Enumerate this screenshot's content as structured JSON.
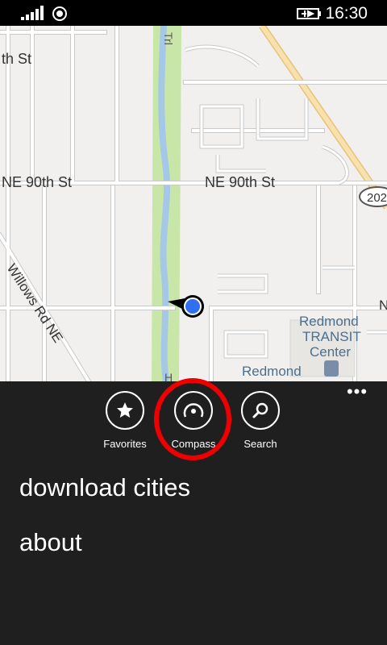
{
  "status_bar": {
    "time": "16:30",
    "icons": [
      "signal-icon",
      "location-icon",
      "battery-charging-icon"
    ]
  },
  "map": {
    "labels": {
      "street_top": "th St",
      "ne90_left": "NE 90th St",
      "ne90_right": "NE 90th St",
      "trl": "Trl",
      "willows": "Willows Rd NE",
      "highway": "202",
      "transit_line1": "Redmond",
      "transit_line2": "TRANSIT",
      "transit_line3": "Center",
      "redmond": "Redmond",
      "n_edge": "N",
      "h_edge": "H"
    },
    "colors": {
      "background": "#f1f0ee",
      "road": "#ffffff",
      "road_outline": "#c9c9c9",
      "park": "#c8e6a8",
      "river": "#a6c8e8",
      "highway": "#f1d79a",
      "location_dot": "#2f6ff0"
    }
  },
  "app_bar": {
    "buttons": [
      {
        "label": "Favorites",
        "icon": "star-icon"
      },
      {
        "label": "Compass",
        "icon": "compass-icon"
      },
      {
        "label": "Search",
        "icon": "search-icon"
      }
    ],
    "more": "•••",
    "highlight_color": "#e00000"
  },
  "menu": {
    "items": [
      "download cities",
      "about"
    ]
  }
}
